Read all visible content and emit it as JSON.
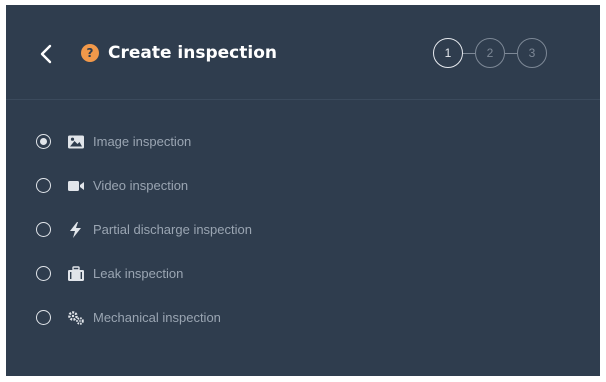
{
  "header": {
    "title": "Create inspection",
    "back_icon": "chevron-left-icon",
    "help_icon": "question-circle-icon",
    "help_symbol": "?",
    "colors": {
      "background": "#2f3d4e",
      "help_icon": "#f2994a",
      "title": "#ffffff"
    }
  },
  "stepper": {
    "steps": [
      {
        "label": "1",
        "active": true
      },
      {
        "label": "2",
        "active": false
      },
      {
        "label": "3",
        "active": false
      }
    ]
  },
  "options": [
    {
      "label": "Image inspection",
      "icon": "image-icon",
      "selected": true
    },
    {
      "label": "Video inspection",
      "icon": "video-camera-icon",
      "selected": false
    },
    {
      "label": "Partial discharge inspection",
      "icon": "lightning-bolt-icon",
      "selected": false
    },
    {
      "label": "Leak inspection",
      "icon": "toolbox-icon",
      "selected": false
    },
    {
      "label": "Mechanical inspection",
      "icon": "gears-icon",
      "selected": false
    }
  ]
}
